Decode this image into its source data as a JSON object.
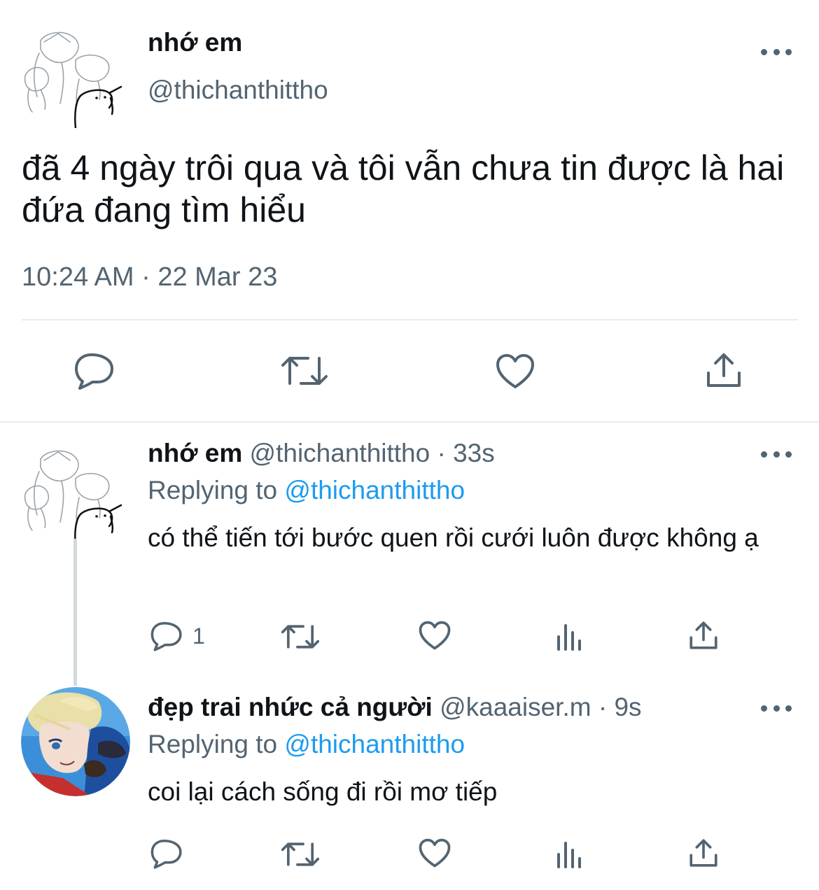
{
  "main_tweet": {
    "name": "nhớ em",
    "handle": "@thichanthittho",
    "text": "đã 4 ngày trôi qua và tôi vẫn chưa tin được là hai đứa đang tìm hiểu",
    "timestamp": "10:24 AM · 22 Mar 23",
    "avatar_icon": "sketch-cats-avatar",
    "actions": [
      "reply-icon",
      "retweet-icon",
      "like-icon",
      "share-icon"
    ]
  },
  "replies": [
    {
      "name": "nhớ em",
      "handle": "@thichanthittho",
      "time": "· 33s",
      "replying_prefix": "Replying to",
      "replying_handle": "@thichanthittho",
      "text": "có thể tiến tới bước quen rồi cưới luôn được không ạ",
      "reply_count": "1",
      "avatar_icon": "sketch-cats-avatar"
    },
    {
      "name": "đẹp trai nhức cả người",
      "handle": "@kaaaiser.m",
      "time": "· 9s",
      "replying_prefix": "Replying to",
      "replying_handle": "@thichanthittho",
      "text": "coi lại cách sống đi rồi mơ tiếp",
      "reply_count": "",
      "avatar_icon": "anime-character-avatar"
    }
  ],
  "colors": {
    "text": "#0f1419",
    "secondary": "#536471",
    "link": "#1d9bf0",
    "divider": "#e6ecf0"
  }
}
